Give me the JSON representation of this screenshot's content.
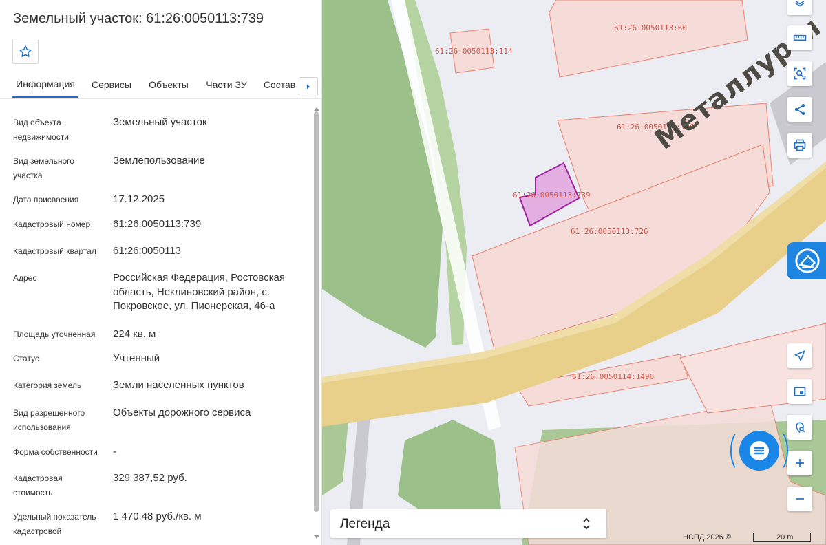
{
  "panel": {
    "title": "Земельный участок: 61:26:0050113:739",
    "favorite_icon": "star-icon",
    "tabs": [
      {
        "label": "Информация",
        "active": true
      },
      {
        "label": "Сервисы"
      },
      {
        "label": "Объекты"
      },
      {
        "label": "Части ЗУ"
      },
      {
        "label": "Состав"
      }
    ],
    "tabs_next_icon": "chevron-right-icon",
    "fields": [
      {
        "label": "Вид объекта недвижимости",
        "value": "Земельный участок"
      },
      {
        "label": "Вид земельного участка",
        "value": "Землепользование"
      },
      {
        "label": "Дата присвоения",
        "value": "17.12.2025"
      },
      {
        "label": "Кадастровый номер",
        "value": "61:26:0050113:739"
      },
      {
        "label": "Кадастровый квартал",
        "value": "61:26:0050113"
      },
      {
        "label": "Адрес",
        "value": "Российская Федерация, Ростовская область, Неклиновский район, с. Покровское, ул. Пионерская, 46-а"
      },
      {
        "label": "Площадь уточненная",
        "value": "224 кв. м"
      },
      {
        "label": "Статус",
        "value": "Учтенный"
      },
      {
        "label": "Категория земель",
        "value": "Земли населенных пунктов"
      },
      {
        "label": "Вид разрешенного использования",
        "value": "Объекты дорожного сервиса"
      },
      {
        "label": "Форма собственности",
        "value": "-"
      },
      {
        "label": "Кадастровая стоимость",
        "value": "329 387,52 руб."
      },
      {
        "label": "Удельный показатель кадастровой",
        "value": "1 470,48 руб./кв. м"
      }
    ]
  },
  "map": {
    "street_name": "Металлурги",
    "lot_labels": [
      "61:26:0050113:60",
      "61:26:0050113:114",
      "61:26:0050113:126",
      "61:26:0050113:739",
      "61:26:0050113:726",
      "61:26:0050114:1496"
    ],
    "colors": {
      "parcel_fill": "#f6dcd8",
      "parcel_stroke": "#e8806f",
      "selected_fill": "#e3aee0",
      "selected_stroke": "#a020a0",
      "road": "#e8cf8a",
      "green": "#9cc08a",
      "accent": "#1e86e0"
    },
    "right_tools": [
      {
        "name": "layers-button",
        "icon": "layers-icon"
      },
      {
        "name": "ruler-button",
        "icon": "ruler-icon"
      },
      {
        "name": "select-area-button",
        "icon": "select-area-icon"
      },
      {
        "name": "share-button",
        "icon": "share-icon"
      },
      {
        "name": "print-button",
        "icon": "print-icon"
      }
    ],
    "bottom_tools": [
      {
        "name": "locate-button",
        "icon": "navigation-arrow-icon"
      },
      {
        "name": "picture-in-picture-button",
        "icon": "minimap-icon"
      },
      {
        "name": "geo-search-button",
        "icon": "location-search-icon"
      },
      {
        "name": "zoom-in-button",
        "icon": "plus-icon"
      },
      {
        "name": "zoom-out-button",
        "icon": "minus-icon"
      }
    ],
    "brand_icon": "nspd-logo-icon",
    "chat_icon": "chat-icon",
    "legend_label": "Легенда",
    "legend_icon": "chevron-up-down-icon",
    "copyright": "НСПД 2026 ©",
    "scale_label": "20 m"
  }
}
